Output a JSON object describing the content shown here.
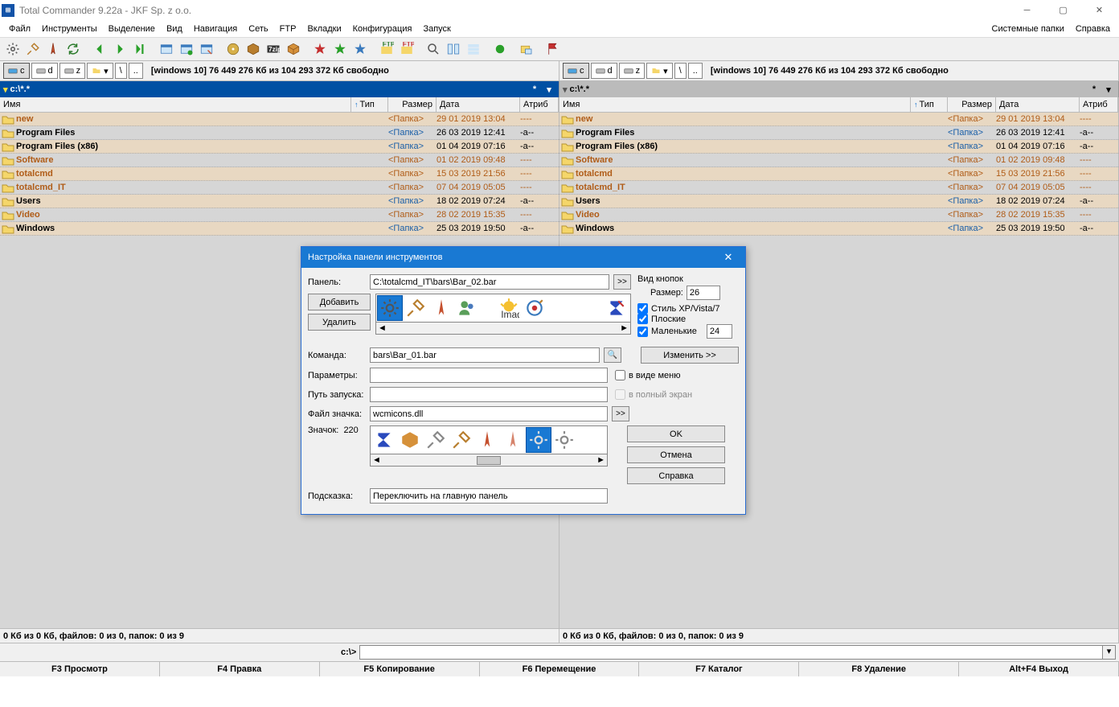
{
  "window": {
    "title": "Total Commander 9.22a - JKF Sp. z o.o."
  },
  "menu": {
    "items": [
      "Файл",
      "Инструменты",
      "Выделение",
      "Вид",
      "Навигация",
      "Сеть",
      "FTP",
      "Вкладки",
      "Конфигурация",
      "Запуск"
    ],
    "right": [
      "Системные папки",
      "Справка"
    ]
  },
  "drives": {
    "left": {
      "buttons": [
        "c",
        "d",
        "z"
      ],
      "path_short": "\\",
      "up": "..",
      "info": "[windows 10]  76 449 276 Кб из 104 293 372 Кб свободно"
    },
    "right": {
      "buttons": [
        "c",
        "d",
        "z"
      ],
      "path_short": "\\",
      "up": "..",
      "info": "[windows 10]  76 449 276 Кб из 104 293 372 Кб свободно"
    }
  },
  "paths": {
    "left": "c:\\*.*",
    "right": "c:\\*.*"
  },
  "columns": {
    "name": "Имя",
    "type": "Тип",
    "size": "Размер",
    "date": "Дата",
    "attr": "Атриб"
  },
  "files": {
    "left": [
      {
        "name": "new",
        "size": "<Папка>",
        "date": "29 01 2019 13:04",
        "attr": "----",
        "style": "orange",
        "hl": true
      },
      {
        "name": "Program Files",
        "size": "<Папка>",
        "date": "26 03 2019 12:41",
        "attr": "-a--",
        "style": "dark",
        "hl": false
      },
      {
        "name": "Program Files (x86)",
        "size": "<Папка>",
        "date": "01 04 2019 07:16",
        "attr": "-a--",
        "style": "dark",
        "hl": true
      },
      {
        "name": "Software",
        "size": "<Папка>",
        "date": "01 02 2019 09:48",
        "attr": "----",
        "style": "orange",
        "hl": false
      },
      {
        "name": "totalcmd",
        "size": "<Папка>",
        "date": "15 03 2019 21:56",
        "attr": "----",
        "style": "orange",
        "hl": true
      },
      {
        "name": "totalcmd_IT",
        "size": "<Папка>",
        "date": "07 04 2019 05:05",
        "attr": "----",
        "style": "orange",
        "hl": false
      },
      {
        "name": "Users",
        "size": "<Папка>",
        "date": "18 02 2019 07:24",
        "attr": "-a--",
        "style": "dark",
        "hl": true
      },
      {
        "name": "Video",
        "size": "<Папка>",
        "date": "28 02 2019 15:35",
        "attr": "----",
        "style": "orange",
        "hl": false
      },
      {
        "name": "Windows",
        "size": "<Папка>",
        "date": "25 03 2019 19:50",
        "attr": "-a--",
        "style": "dark",
        "hl": true
      }
    ],
    "right": [
      {
        "name": "new",
        "size": "<Папка>",
        "date": "29 01 2019 13:04",
        "attr": "----",
        "style": "orange",
        "hl": true
      },
      {
        "name": "Program Files",
        "size": "<Папка>",
        "date": "26 03 2019 12:41",
        "attr": "-a--",
        "style": "dark",
        "hl": false
      },
      {
        "name": "Program Files (x86)",
        "size": "<Папка>",
        "date": "01 04 2019 07:16",
        "attr": "-a--",
        "style": "dark",
        "hl": true
      },
      {
        "name": "Software",
        "size": "<Папка>",
        "date": "01 02 2019 09:48",
        "attr": "----",
        "style": "orange",
        "hl": false
      },
      {
        "name": "totalcmd",
        "size": "<Папка>",
        "date": "15 03 2019 21:56",
        "attr": "----",
        "style": "orange",
        "hl": true
      },
      {
        "name": "totalcmd_IT",
        "size": "<Папка>",
        "date": "07 04 2019 05:05",
        "attr": "----",
        "style": "orange",
        "hl": false
      },
      {
        "name": "Users",
        "size": "<Папка>",
        "date": "18 02 2019 07:24",
        "attr": "-a--",
        "style": "dark",
        "hl": true
      },
      {
        "name": "Video",
        "size": "<Папка>",
        "date": "28 02 2019 15:35",
        "attr": "----",
        "style": "orange",
        "hl": false
      },
      {
        "name": "Windows",
        "size": "<Папка>",
        "date": "25 03 2019 19:50",
        "attr": "-a--",
        "style": "dark",
        "hl": true
      }
    ]
  },
  "status": {
    "left": "0 Кб из 0 Кб, файлов: 0 из 0, папок: 0 из 9",
    "right": "0 Кб из 0 Кб, файлов: 0 из 0, папок: 0 из 9"
  },
  "cmdline": {
    "label": "c:\\>"
  },
  "fkeys": [
    "F3 Просмотр",
    "F4 Правка",
    "F5 Копирование",
    "F6 Перемещение",
    "F7 Каталог",
    "F8 Удаление",
    "Alt+F4 Выход"
  ],
  "dialog": {
    "title": "Настройка панели инструментов",
    "labels": {
      "panel": "Панель:",
      "add": "Добавить",
      "delete": "Удалить",
      "command": "Команда:",
      "params": "Параметры:",
      "startpath": "Путь запуска:",
      "iconfile": "Файл значка:",
      "icon": "Значок:",
      "tooltip": "Подсказка:",
      "buttons_group": "Вид кнопок",
      "size": "Размер:",
      "xp_style": "Стиль XP/Vista/7",
      "flat": "Плоские",
      "small": "Маленькие",
      "change": "Изменить >>",
      "as_menu": "в виде меню",
      "fullscreen": "в полный экран",
      "ok": "OK",
      "cancel": "Отмена",
      "help": "Справка",
      "icon_count": "220",
      "browse": ">>"
    },
    "values": {
      "panel_path": "C:\\totalcmd_IT\\bars\\Bar_02.bar",
      "command": "bars\\Bar_01.bar",
      "params": "",
      "startpath": "",
      "iconfile": "wcmicons.dll",
      "tooltip": "Переключить на главную панель",
      "size": "26",
      "small_size": "24",
      "xp_checked": true,
      "flat_checked": true,
      "small_checked": true,
      "as_menu_checked": false
    }
  }
}
